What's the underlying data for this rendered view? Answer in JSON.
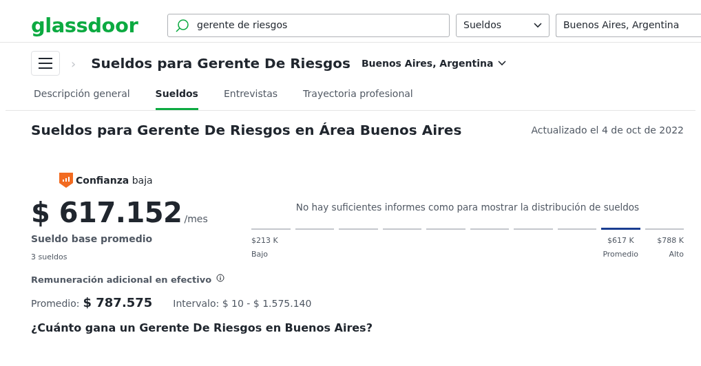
{
  "header": {
    "logo": "glassdoor",
    "search": {
      "value": "gerente de riesgos"
    },
    "category": {
      "value": "Sueldos"
    },
    "location": {
      "value": "Buenos Aires, Argentina"
    }
  },
  "breadcrumb": {
    "separator": "›",
    "title": "Sueldos para Gerente De Riesgos",
    "location": "Buenos Aires, Argentina"
  },
  "tabs": [
    {
      "label": "Descripción general",
      "selected": false
    },
    {
      "label": "Sueldos",
      "selected": true
    },
    {
      "label": "Entrevistas",
      "selected": false
    },
    {
      "label": "Trayectoria profesional",
      "selected": false
    }
  ],
  "page": {
    "title": "Sueldos para Gerente De Riesgos en Área Buenos Aires",
    "updated": "Actualizado el 4 de oct de 2022"
  },
  "confidence": {
    "text": "**Confianza** baja",
    "color": "#f26b21"
  },
  "salary": {
    "amount": "$ 617.152",
    "unit": "/mes",
    "label": "Sueldo base promedio",
    "count": "3 sueldos"
  },
  "distribution": {
    "message": "No hay suficientes informes como para mostrar la distribución de sueldos",
    "segments": [
      {
        "selected": false,
        "value": "$213 K",
        "label": "Bajo"
      },
      {
        "selected": false
      },
      {
        "selected": false
      },
      {
        "selected": false
      },
      {
        "selected": false
      },
      {
        "selected": false
      },
      {
        "selected": false
      },
      {
        "selected": false
      },
      {
        "selected": true,
        "value": "$617 K",
        "label": "Promedio"
      },
      {
        "selected": false,
        "value": "$788 K",
        "label": "Alto"
      }
    ]
  },
  "additional": {
    "title": "Remuneración adicional en efectivo",
    "average_label": "Promedio:",
    "average": "$ 787.575",
    "range": "Intervalo: $ 10 - $ 1.575.140"
  },
  "question": "¿Cuánto gana un Gerente De Riesgos en Buenos Aires?"
}
